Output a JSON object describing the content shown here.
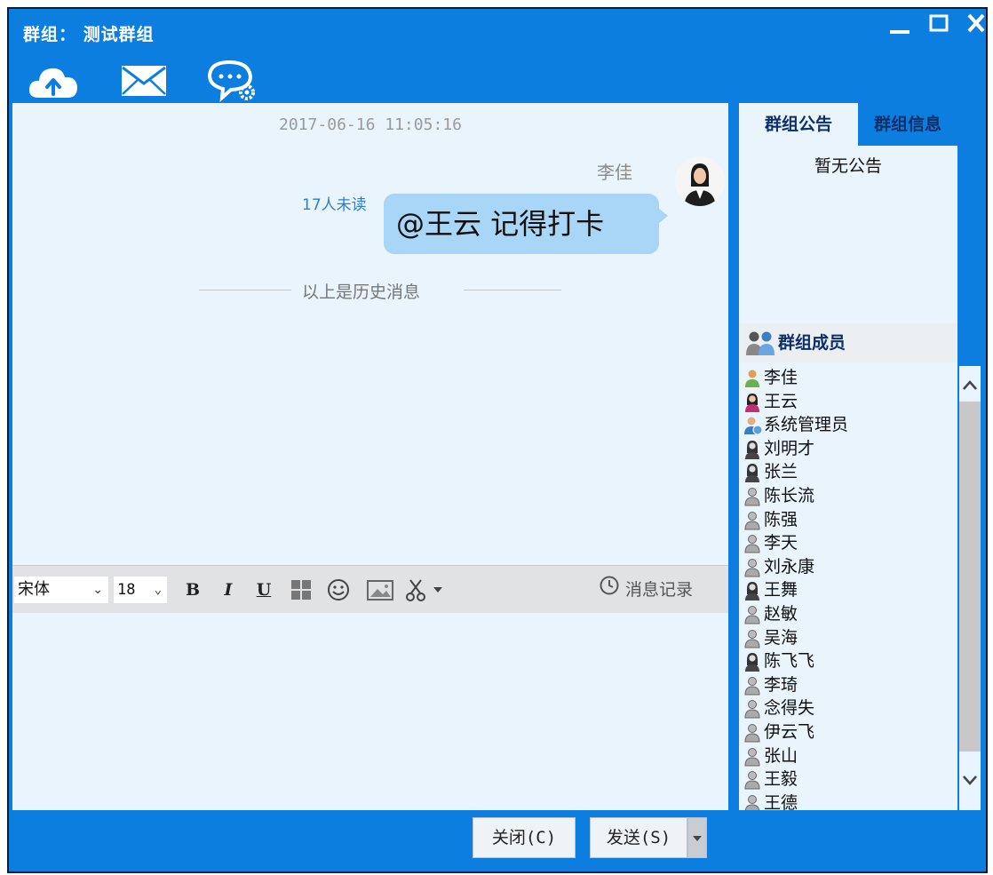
{
  "window": {
    "title": "群组： 测试群组",
    "colors": {
      "frame": "#0c7ee0",
      "chat_bg": "#e9f4fd",
      "bubble": "#a9d6f6"
    }
  },
  "toolbar": {
    "icons": [
      "cloud-upload-icon",
      "mail-icon",
      "chat-settings-icon"
    ]
  },
  "chat": {
    "timestamp": "2017-06-16 11:05:16",
    "messages": [
      {
        "sender": "李佳",
        "text": "@王云  记得打卡",
        "unread": "17人未读"
      }
    ],
    "history_divider": "以上是历史消息"
  },
  "format_bar": {
    "font": "宋体",
    "size": "18",
    "bold": "B",
    "italic": "I",
    "underline": "U",
    "history_label": "消息记录"
  },
  "side": {
    "tabs": [
      "群组公告",
      "群组信息"
    ],
    "active_tab": "群组公告",
    "notice": "暂无公告",
    "members_title": "群组成员",
    "members": [
      {
        "name": "李佳",
        "icon": "user-orange-icon"
      },
      {
        "name": "王云",
        "icon": "user-female-icon"
      },
      {
        "name": "系统管理员",
        "icon": "user-admin-icon"
      },
      {
        "name": "刘明才",
        "icon": "user-female-gray-icon"
      },
      {
        "name": "张兰",
        "icon": "user-female-gray-icon"
      },
      {
        "name": "陈长流",
        "icon": "user-gray-icon"
      },
      {
        "name": "陈强",
        "icon": "user-gray-icon"
      },
      {
        "name": "李天",
        "icon": "user-gray-icon"
      },
      {
        "name": "刘永康",
        "icon": "user-gray-icon"
      },
      {
        "name": "王舞",
        "icon": "user-female-gray-icon"
      },
      {
        "name": "赵敏",
        "icon": "user-gray-icon"
      },
      {
        "name": "吴海",
        "icon": "user-gray-icon"
      },
      {
        "name": "陈飞飞",
        "icon": "user-female-gray-icon"
      },
      {
        "name": "李琦",
        "icon": "user-gray-icon"
      },
      {
        "name": "念得失",
        "icon": "user-gray-icon"
      },
      {
        "name": "伊云飞",
        "icon": "user-gray-icon"
      },
      {
        "name": "张山",
        "icon": "user-gray-icon"
      },
      {
        "name": "王毅",
        "icon": "user-gray-icon"
      },
      {
        "name": "王德",
        "icon": "user-gray-icon"
      }
    ]
  },
  "actions": {
    "close": "关闭(C)",
    "send": "发送(S)"
  }
}
